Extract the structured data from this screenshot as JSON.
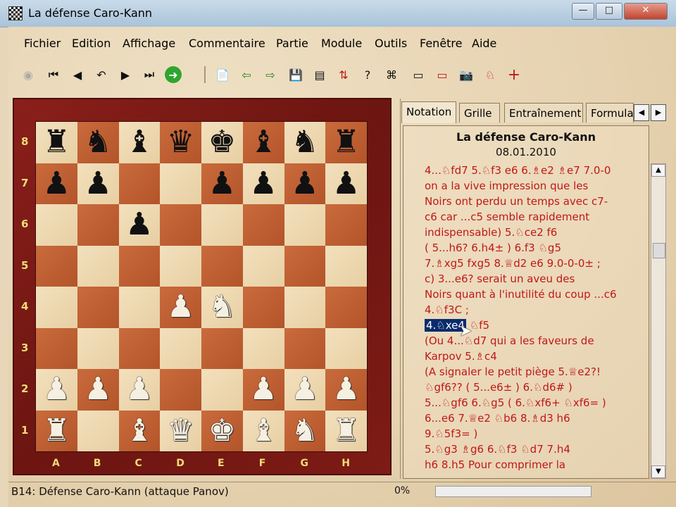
{
  "window": {
    "title": "La défense Caro-Kann",
    "minimize_glyph": "—",
    "maximize_glyph": "□",
    "close_glyph": "✕"
  },
  "menu": [
    "Fichier",
    "Edition",
    "Affichage",
    "Commentaire",
    "Partie",
    "Module",
    "Outils",
    "Fenêtre",
    "Aide"
  ],
  "toolbar": {
    "nav": [
      "◉",
      "⏮",
      "◀",
      "↶",
      "▶",
      "⏭",
      "➜"
    ],
    "actions": [
      "📄",
      "⇦",
      "⇨",
      "💾",
      "▤",
      "⇅",
      "?",
      "⌘",
      "▭",
      "▭",
      "📷",
      "♘",
      "+"
    ]
  },
  "board": {
    "ranks": [
      "8",
      "7",
      "6",
      "5",
      "4",
      "3",
      "2",
      "1"
    ],
    "files": [
      "A",
      "B",
      "C",
      "D",
      "E",
      "F",
      "G",
      "H"
    ],
    "position": [
      [
        "bR",
        "bN",
        "bB",
        "bQ",
        "bK",
        "bB",
        "bN",
        "bR"
      ],
      [
        "bP",
        "bP",
        "",
        "",
        "bP",
        "bP",
        "bP",
        "bP"
      ],
      [
        "",
        "",
        "bP",
        "",
        "",
        "",
        "",
        ""
      ],
      [
        "",
        "",
        "",
        "",
        "",
        "",
        "",
        ""
      ],
      [
        "",
        "",
        "",
        "wP",
        "wN",
        "",
        "",
        ""
      ],
      [
        "",
        "",
        "",
        "",
        "",
        "",
        "",
        ""
      ],
      [
        "wP",
        "wP",
        "wP",
        "",
        "",
        "wP",
        "wP",
        "wP"
      ],
      [
        "wR",
        "",
        "wB",
        "wQ",
        "wK",
        "wB",
        "wN",
        "wR"
      ]
    ]
  },
  "tabs": [
    "Notation",
    "Grille",
    "Entraînement",
    "Formulai"
  ],
  "notation": {
    "title": "La défense Caro-Kann",
    "date": "08.01.2010",
    "lines": [
      "4...♘fd7 5.♘f3 e6 6.♗e2 ♗e7 7.0-0",
      "on a la vive impression que les",
      "Noirs ont perdu un temps avec c7-",
      "c6 car ...c5 semble rapidement",
      "indispensable) 5.♘ce2 f6",
      "( 5...h6? 6.h4± ) 6.f3 ♘g5",
      "7.♗xg5 fxg5 8.♕d2 e6 9.0-0-0± ;",
      "c) 3...e6? serait un aveu des",
      "Noirs quant à l'inutilité du coup ...c6",
      "4.♘f3C ;",
      "4.♘xe4 ♘f5",
      "(Ou 4...♘d7 qui a les faveurs de",
      "Karpov 5.♗c4",
      "(A signaler le petit piège 5.♕e2?!",
      "♘gf6?? ( 5...e6± ) 6.♘d6# )",
      "5...♘gf6 6.♘g5 ( 6.♘xf6+ ♘xf6= )",
      "6...e6 7.♕e2 ♘b6 8.♗d3 h6",
      "9.♘5f3= )",
      "5.♘g3 ♗g6 6.♘f3 ♘d7 7.h4",
      "h6 8.h5 Pour comprimer la"
    ],
    "highlight": "4.♘xe4"
  },
  "status": {
    "text": "B14: Défense Caro-Kann (attaque Panov)",
    "progress_label": "0%",
    "progress": 0
  },
  "colors": {
    "accent": "#c01818",
    "highlight": "#0b2b6e",
    "board_frame": "#7a1a16"
  }
}
